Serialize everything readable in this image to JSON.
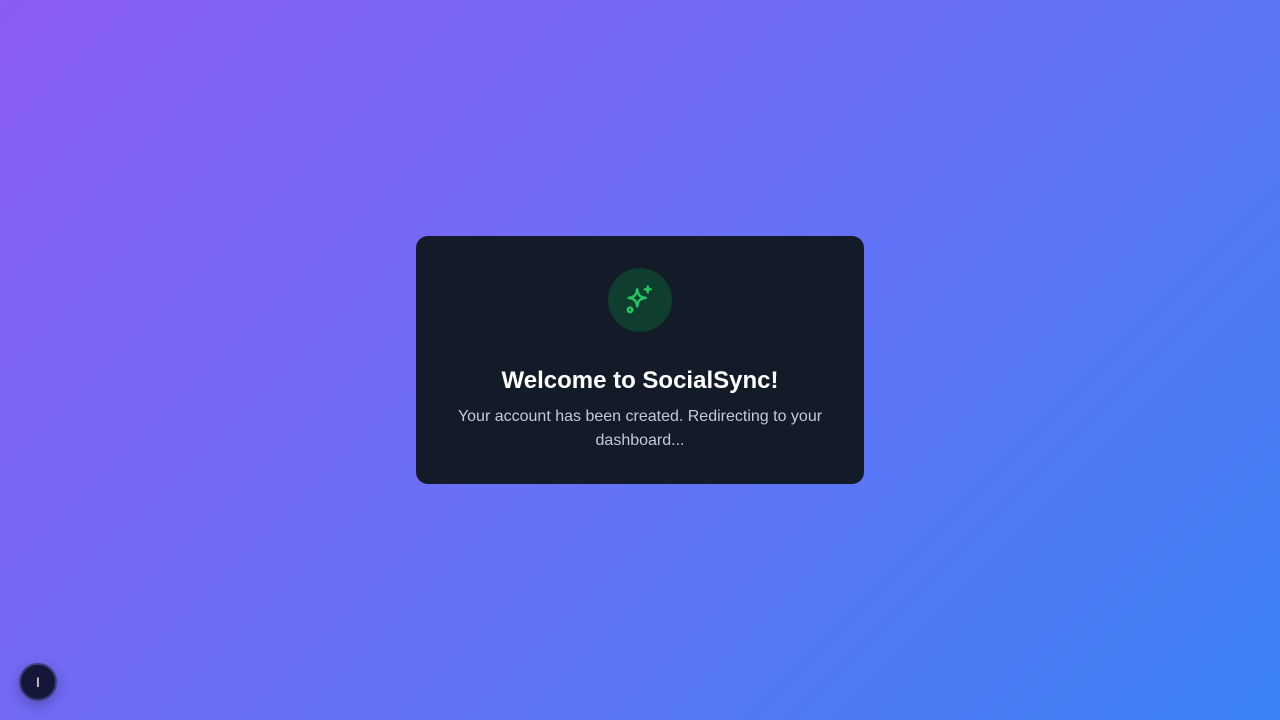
{
  "background": {
    "gradient_start": "#8b5cf6",
    "gradient_end": "#3b82f6"
  },
  "dialog": {
    "icon": "sparkles-icon",
    "icon_color": "#22c55e",
    "title": "Welcome to SocialSync!",
    "message": "Your account has been created. Redirecting to your dashboard..."
  },
  "floating_button": {
    "label": "I"
  }
}
